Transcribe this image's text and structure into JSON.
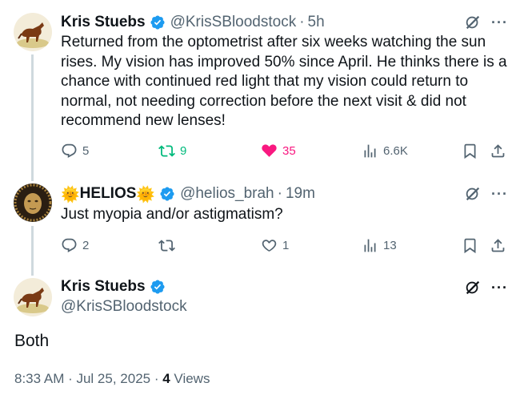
{
  "tweet1": {
    "name": "Kris Stuebs",
    "handle": "@KrisSBloodstock",
    "time": "5h",
    "text": "Returned from the optometrist after six weeks watching the sun rises. My vision has improved 50% since April. He thinks there is a chance with continued red light that my vision could return to normal, not needing correction before the next visit & did not recommend new lenses!",
    "replies": "5",
    "reposts": "9",
    "likes": "35",
    "views": "6.6K"
  },
  "tweet2": {
    "name_emoji_left": "🌞",
    "name": "HELIOS",
    "name_emoji_right": "🌞",
    "handle": "@helios_brah",
    "time": "19m",
    "text": "Just myopia and/or astigmatism?",
    "replies": "2",
    "reposts": "",
    "likes": "1",
    "views": "13"
  },
  "tweet3": {
    "name": "Kris Stuebs",
    "handle": "@KrisSBloodstock",
    "text": "Both",
    "timestamp": "8:33 AM · Jul 25, 2025 · ",
    "views_count": "4",
    "views_label": " Views"
  },
  "colors": {
    "verified": "#1d9bf0",
    "repost_active": "#00ba7c",
    "like_active": "#f91880",
    "secondary_text": "#536471",
    "thread_line": "#cfd9de"
  },
  "icons": {
    "reply": "reply-icon",
    "repost": "repost-icon",
    "like": "heart-icon",
    "views": "views-icon",
    "bookmark": "bookmark-icon",
    "share": "share-icon",
    "grok": "grok-icon",
    "more": "more-icon"
  }
}
